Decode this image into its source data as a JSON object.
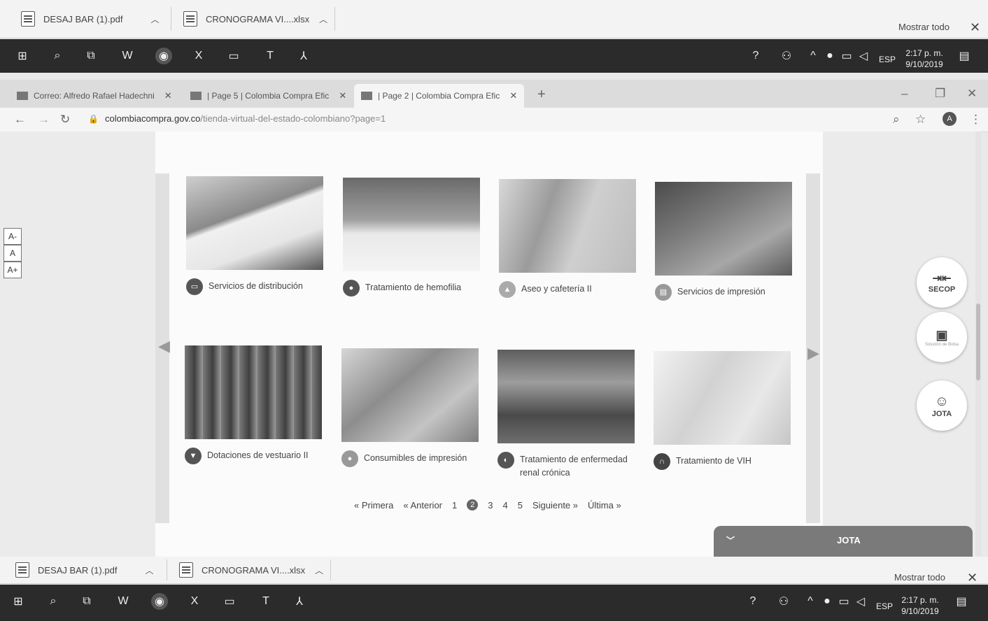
{
  "top_downloads": {
    "items": [
      {
        "name": "DESAJ BAR (1).pdf"
      },
      {
        "name": "CRONOGRAMA VI....xlsx"
      }
    ],
    "show_all": "Mostrar todo"
  },
  "taskbar": {
    "time": "2:17 p. m.",
    "date": "9/10/2019",
    "language": "ESP"
  },
  "browser": {
    "tabs": [
      {
        "title": "Correo: Alfredo Rafael Hadechni"
      },
      {
        "title": "| Page 5 | Colombia Compra Efic"
      },
      {
        "title": "| Page 2 | Colombia Compra Efic"
      }
    ],
    "url_host": "colombiacompra.gov.co",
    "url_path": "/tienda-virtual-del-estado-colombiano?page=1",
    "profile_initial": "A"
  },
  "catalog": {
    "cards": [
      {
        "label": "Servicios de distribución"
      },
      {
        "label": "Tratamiento de hemofilia"
      },
      {
        "label": "Aseo y cafetería II"
      },
      {
        "label": "Servicios de impresión"
      },
      {
        "label": "Dotaciones de vestuario II"
      },
      {
        "label": "Consumibles de impresión"
      },
      {
        "label": "Tratamiento de enfermedad renal crónica"
      },
      {
        "label": "Tratamiento de VIH"
      }
    ],
    "pagination": {
      "first": "« Primera",
      "prev": "« Anterior",
      "pages": [
        "1",
        "2",
        "3",
        "4",
        "5"
      ],
      "current": "2",
      "next": "Siguiente »",
      "last": "Última »"
    }
  },
  "accessibility": {
    "decrease": "A-",
    "normal": "A",
    "increase": "A+"
  },
  "floating": {
    "secop": "SECOP",
    "bolsa": "Solución de Bolsa",
    "jota": "JOTA",
    "jota_panel": "JOTA"
  },
  "bottom_downloads": {
    "items": [
      {
        "name": "DESAJ BAR (1).pdf"
      },
      {
        "name": "CRONOGRAMA VI....xlsx"
      }
    ],
    "show_all": "Mostrar todo"
  }
}
